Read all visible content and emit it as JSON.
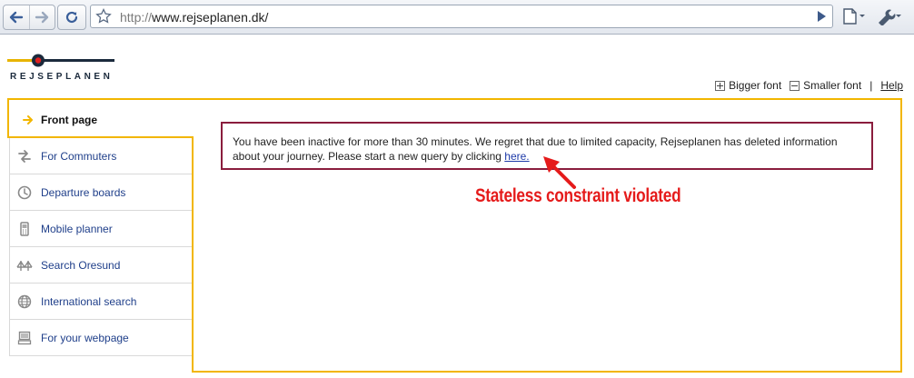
{
  "browser": {
    "url_protocol": "http://",
    "url_host": "www.rejseplanen.dk/"
  },
  "site": {
    "logo_text": "REJSEPLANEN",
    "bigger_font": "Bigger font",
    "smaller_font": "Smaller font",
    "separator": "|",
    "help": "Help"
  },
  "nav": {
    "active": "Front page",
    "items": [
      {
        "label": "For Commuters",
        "icon": "commuter-arrows-icon"
      },
      {
        "label": "Departure boards",
        "icon": "clock-icon"
      },
      {
        "label": "Mobile planner",
        "icon": "mobile-phone-icon"
      },
      {
        "label": "Search Oresund",
        "icon": "bridge-icon"
      },
      {
        "label": "International search",
        "icon": "globe-icon"
      },
      {
        "label": "For your webpage",
        "icon": "computer-icon"
      }
    ]
  },
  "message": {
    "text": "You have been inactive for more than 30 minutes. We regret that due to limited capacity, Rejseplanen has deleted information about your journey. Please start a new query by clicking",
    "link": "here."
  },
  "annotation": "Stateless constraint violated",
  "colors": {
    "frame": "#f2b600",
    "message_border": "#8a1d3d",
    "annotation": "#e51b1b",
    "nav_link": "#1f3f8a"
  }
}
